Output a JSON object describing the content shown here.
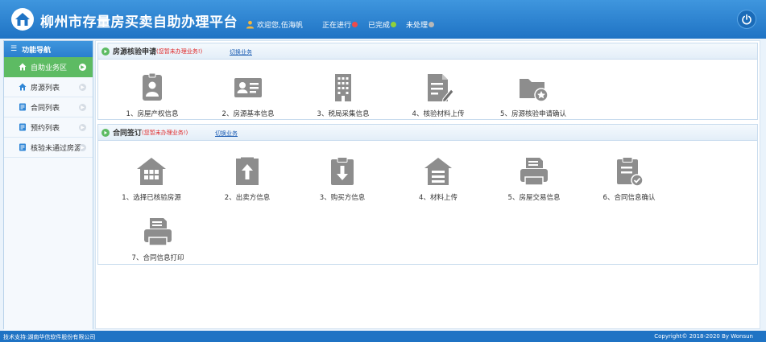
{
  "header": {
    "title": "柳州市存量房买卖自助办理平台",
    "welcome": "欢迎您,伍海帆",
    "status": [
      {
        "label": "正在进行",
        "color": "#ee4b4b"
      },
      {
        "label": "已完成",
        "color": "#8fd13b"
      },
      {
        "label": "未处理",
        "color": "#b8b8b8"
      }
    ]
  },
  "sidebar": {
    "heading": "功能导航",
    "items": [
      {
        "label": "自助业务区",
        "icon": "home-icon",
        "active": true
      },
      {
        "label": "房源列表",
        "icon": "house-list-icon"
      },
      {
        "label": "合同列表",
        "icon": "contract-list-icon"
      },
      {
        "label": "预约列表",
        "icon": "appointment-list-icon"
      },
      {
        "label": "核验未通过房源",
        "icon": "rejected-list-icon"
      }
    ]
  },
  "panels": [
    {
      "title": "房源核验申请",
      "note": "(您暂未办理业务!)",
      "switch": "切换业务",
      "tiles": [
        {
          "label": "1、房屋产权信息",
          "icon": "id-badge-icon"
        },
        {
          "label": "2、房源基本信息",
          "icon": "id-card-icon"
        },
        {
          "label": "3、税局采集信息",
          "icon": "building-icon"
        },
        {
          "label": "4、核验材料上传",
          "icon": "document-edit-icon"
        },
        {
          "label": "5、房源核验申请确认",
          "icon": "folder-star-icon"
        }
      ]
    },
    {
      "title": "合同签订",
      "note": "(您暂未办理业务!)",
      "switch": "切换业务",
      "tiles": [
        {
          "label": "1、选择已核验房源",
          "icon": "house-grid-icon"
        },
        {
          "label": "2、出卖方信息",
          "icon": "upload-box-icon"
        },
        {
          "label": "3、购买方信息",
          "icon": "download-clipboard-icon"
        },
        {
          "label": "4、材料上传",
          "icon": "house-lines-icon"
        },
        {
          "label": "5、房屋交易信息",
          "icon": "printer-icon"
        },
        {
          "label": "6、合同信息确认",
          "icon": "clipboard-check-icon"
        },
        {
          "label": "7、合同信息打印",
          "icon": "printer-icon"
        }
      ]
    }
  ],
  "footer": {
    "support": "技术支持:湖南华信软件股份有限公司",
    "copyright": "Copyright© 2018-2020 By Wonsun"
  }
}
